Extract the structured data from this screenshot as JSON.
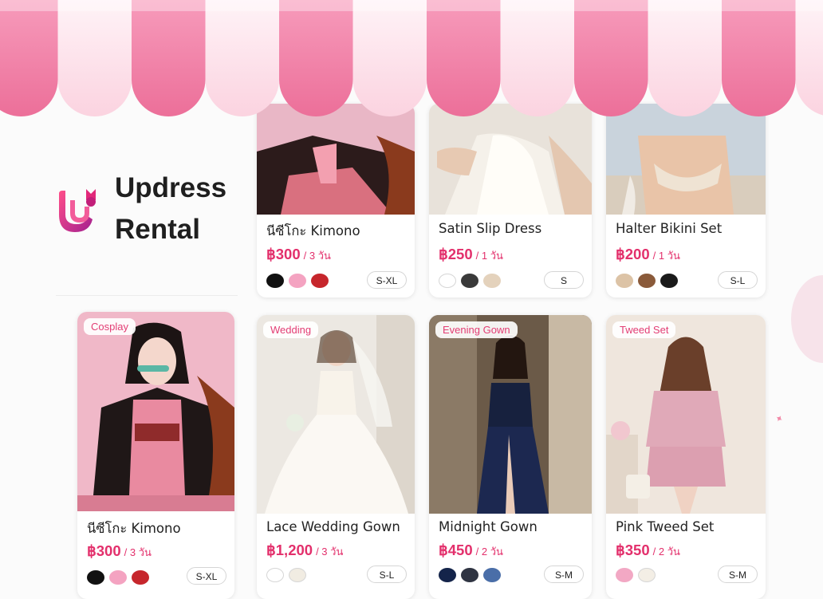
{
  "brand": {
    "name_line1": "Updress",
    "name_line2": "Rental"
  },
  "colors": {
    "accent": "#e3306c",
    "awning_pink": "#f07fa3",
    "awning_light": "#fde3eb"
  },
  "products": [
    {
      "name": "นีซีโกะ Kimono",
      "price": "฿300",
      "period": "/ 3 วัน",
      "size": "S-XL",
      "swatches": [
        "#111111",
        "#f4a3c1",
        "#c6262c"
      ],
      "tag": ""
    },
    {
      "name": "Satin Slip Dress",
      "price": "฿250",
      "period": "/ 1 วัน",
      "size": "S",
      "swatches": [
        "#ffffff",
        "#3a3a3a",
        "#e4d2bc"
      ],
      "tag": ""
    },
    {
      "name": "Halter Bikini Set",
      "price": "฿200",
      "period": "/ 1 วัน",
      "size": "S-L",
      "swatches": [
        "#dcc3a6",
        "#8a5a3a",
        "#1a1a1a"
      ],
      "tag": ""
    },
    {
      "name": "นีซีโกะ Kimono",
      "price": "฿300",
      "period": "/ 3 วัน",
      "size": "S-XL",
      "swatches": [
        "#111111",
        "#f4a3c1",
        "#c6262c"
      ],
      "tag": "Cosplay"
    },
    {
      "name": "Lace Wedding Gown",
      "price": "฿1,200",
      "period": "/ 3 วัน",
      "size": "S-L",
      "swatches": [
        "#ffffff",
        "#f1ece2"
      ],
      "tag": "Wedding"
    },
    {
      "name": "Midnight Gown",
      "price": "฿450",
      "period": "/ 2 วัน",
      "size": "S-M",
      "swatches": [
        "#14244a",
        "#2f3442",
        "#4a6ea8"
      ],
      "tag": "Evening Gown"
    },
    {
      "name": "Pink Tweed Set",
      "price": "฿350",
      "period": "/ 2 วัน",
      "size": "S-M",
      "swatches": [
        "#f2a8c4",
        "#f3eee5"
      ],
      "tag": "Tweed Set"
    }
  ]
}
